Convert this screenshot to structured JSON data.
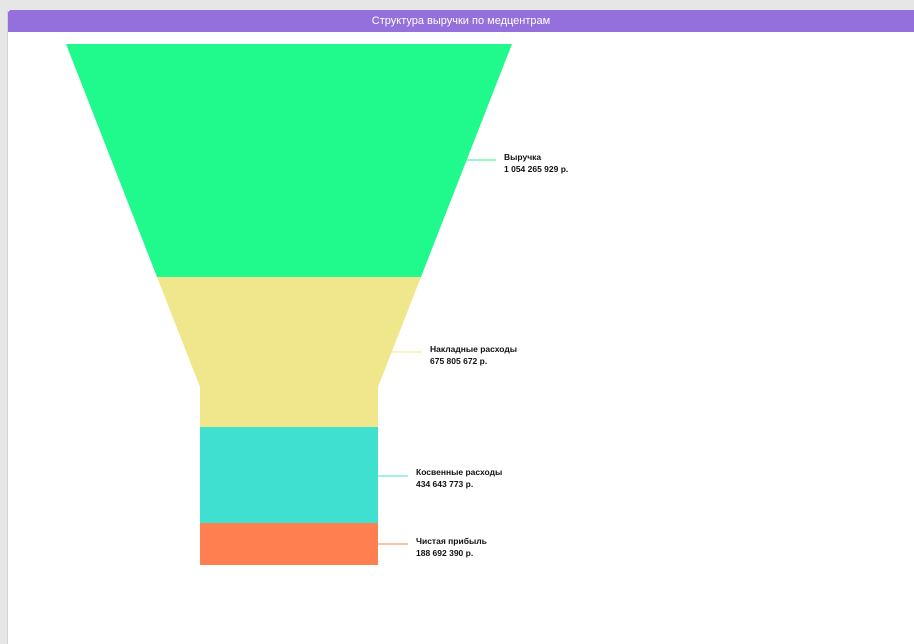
{
  "panel": {
    "title": "Структура выручки по медцентрам",
    "header_color": "#9370db"
  },
  "chart_data": {
    "type": "funnel",
    "title": "Структура выручки по медцентрам",
    "stages": [
      {
        "name": "Выручка",
        "value_label": "1 054 265 929 р.",
        "value": 1054265929,
        "color": "#20fa8c"
      },
      {
        "name": "Накладные расходы",
        "value_label": "675 805 672 р.",
        "value": 675805672,
        "color": "#f0e68c"
      },
      {
        "name": "Косвенные расходы",
        "value_label": "434 643 773 р.",
        "value": 434643773,
        "color": "#40e0d0"
      },
      {
        "name": "Чистая прибыль",
        "value_label": "188 692 390 р.",
        "value": 188692390,
        "color": "#ff7f50"
      }
    ],
    "legend": "none",
    "labels_position": "right"
  }
}
